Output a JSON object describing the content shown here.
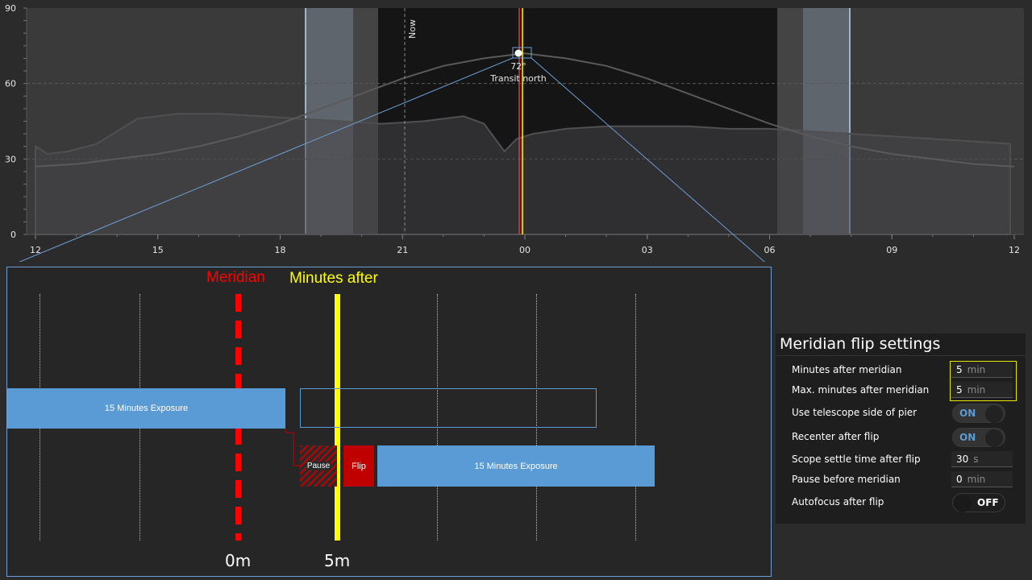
{
  "chart_data": {
    "type": "area",
    "xlabel": "",
    "ylabel": "",
    "x_ticks": [
      "12",
      "15",
      "18",
      "21",
      "00",
      "03",
      "06",
      "09",
      "12"
    ],
    "y_ticks": [
      0,
      30,
      60,
      90
    ],
    "ylim": [
      0,
      90
    ],
    "grid": true,
    "series": [
      {
        "x": [
          12,
          13,
          14,
          15,
          16,
          17,
          18,
          19,
          20,
          21,
          22,
          23,
          24,
          25,
          26,
          27,
          28,
          29,
          30,
          31,
          32,
          33,
          34,
          35,
          36
        ],
        "values": [
          27,
          28,
          30,
          32,
          35,
          39,
          44,
          50,
          56,
          62,
          67,
          70,
          72,
          70,
          67,
          62,
          56,
          50,
          44,
          39,
          35,
          32,
          30,
          28,
          27
        ]
      },
      {
        "x": [
          12,
          12.3,
          12.8,
          13.5,
          14.5,
          15.5,
          16.5,
          17.5,
          18.5,
          19.5,
          20.5,
          21.5,
          22.5,
          23,
          23.5,
          23.8,
          24.2,
          25,
          26,
          27,
          28,
          29,
          30,
          31,
          32,
          33,
          34,
          35,
          35.9
        ],
        "values": [
          35,
          32,
          33,
          36,
          46,
          48,
          48,
          47,
          46,
          45,
          44,
          45,
          47,
          44,
          33,
          38,
          40,
          42,
          43,
          43,
          43,
          42,
          42,
          41,
          40,
          39,
          38,
          37,
          36
        ]
      }
    ],
    "annotations": {
      "now_label": "Now",
      "transit_altitude": "72°",
      "transit_label": "Transit north"
    }
  },
  "zoom": {
    "meridian_label": "Meridian",
    "minutes_after_label": "Minutes after",
    "zero_label": "0m",
    "five_label": "5m",
    "exposure_label_1": "15 Minutes Exposure",
    "exposure_label_2": "15 Minutes Exposure",
    "pause_label": "Pause",
    "flip_label": "Flip",
    "colors": {
      "meridian": "#ff0000",
      "minutes_after": "#ffff00",
      "exposure": "#5b9bd5",
      "flip": "#c00000"
    }
  },
  "settings": {
    "title": "Meridian flip settings",
    "minutes_after": {
      "label": "Minutes after meridian",
      "value": "5",
      "unit": "min"
    },
    "max_minutes_after": {
      "label": "Max. minutes after meridian",
      "value": "5",
      "unit": "min"
    },
    "telescope_side": {
      "label": "Use telescope side of pier",
      "state": "ON"
    },
    "recenter": {
      "label": "Recenter after flip",
      "state": "ON"
    },
    "settle_time": {
      "label": "Scope settle time after flip",
      "value": "30",
      "unit": "s"
    },
    "pause_before": {
      "label": "Pause before meridian",
      "value": "0",
      "unit": "min"
    },
    "autofocus": {
      "label": "Autofocus after flip",
      "state": "OFF"
    },
    "accent_color": "#5b9bd5"
  }
}
